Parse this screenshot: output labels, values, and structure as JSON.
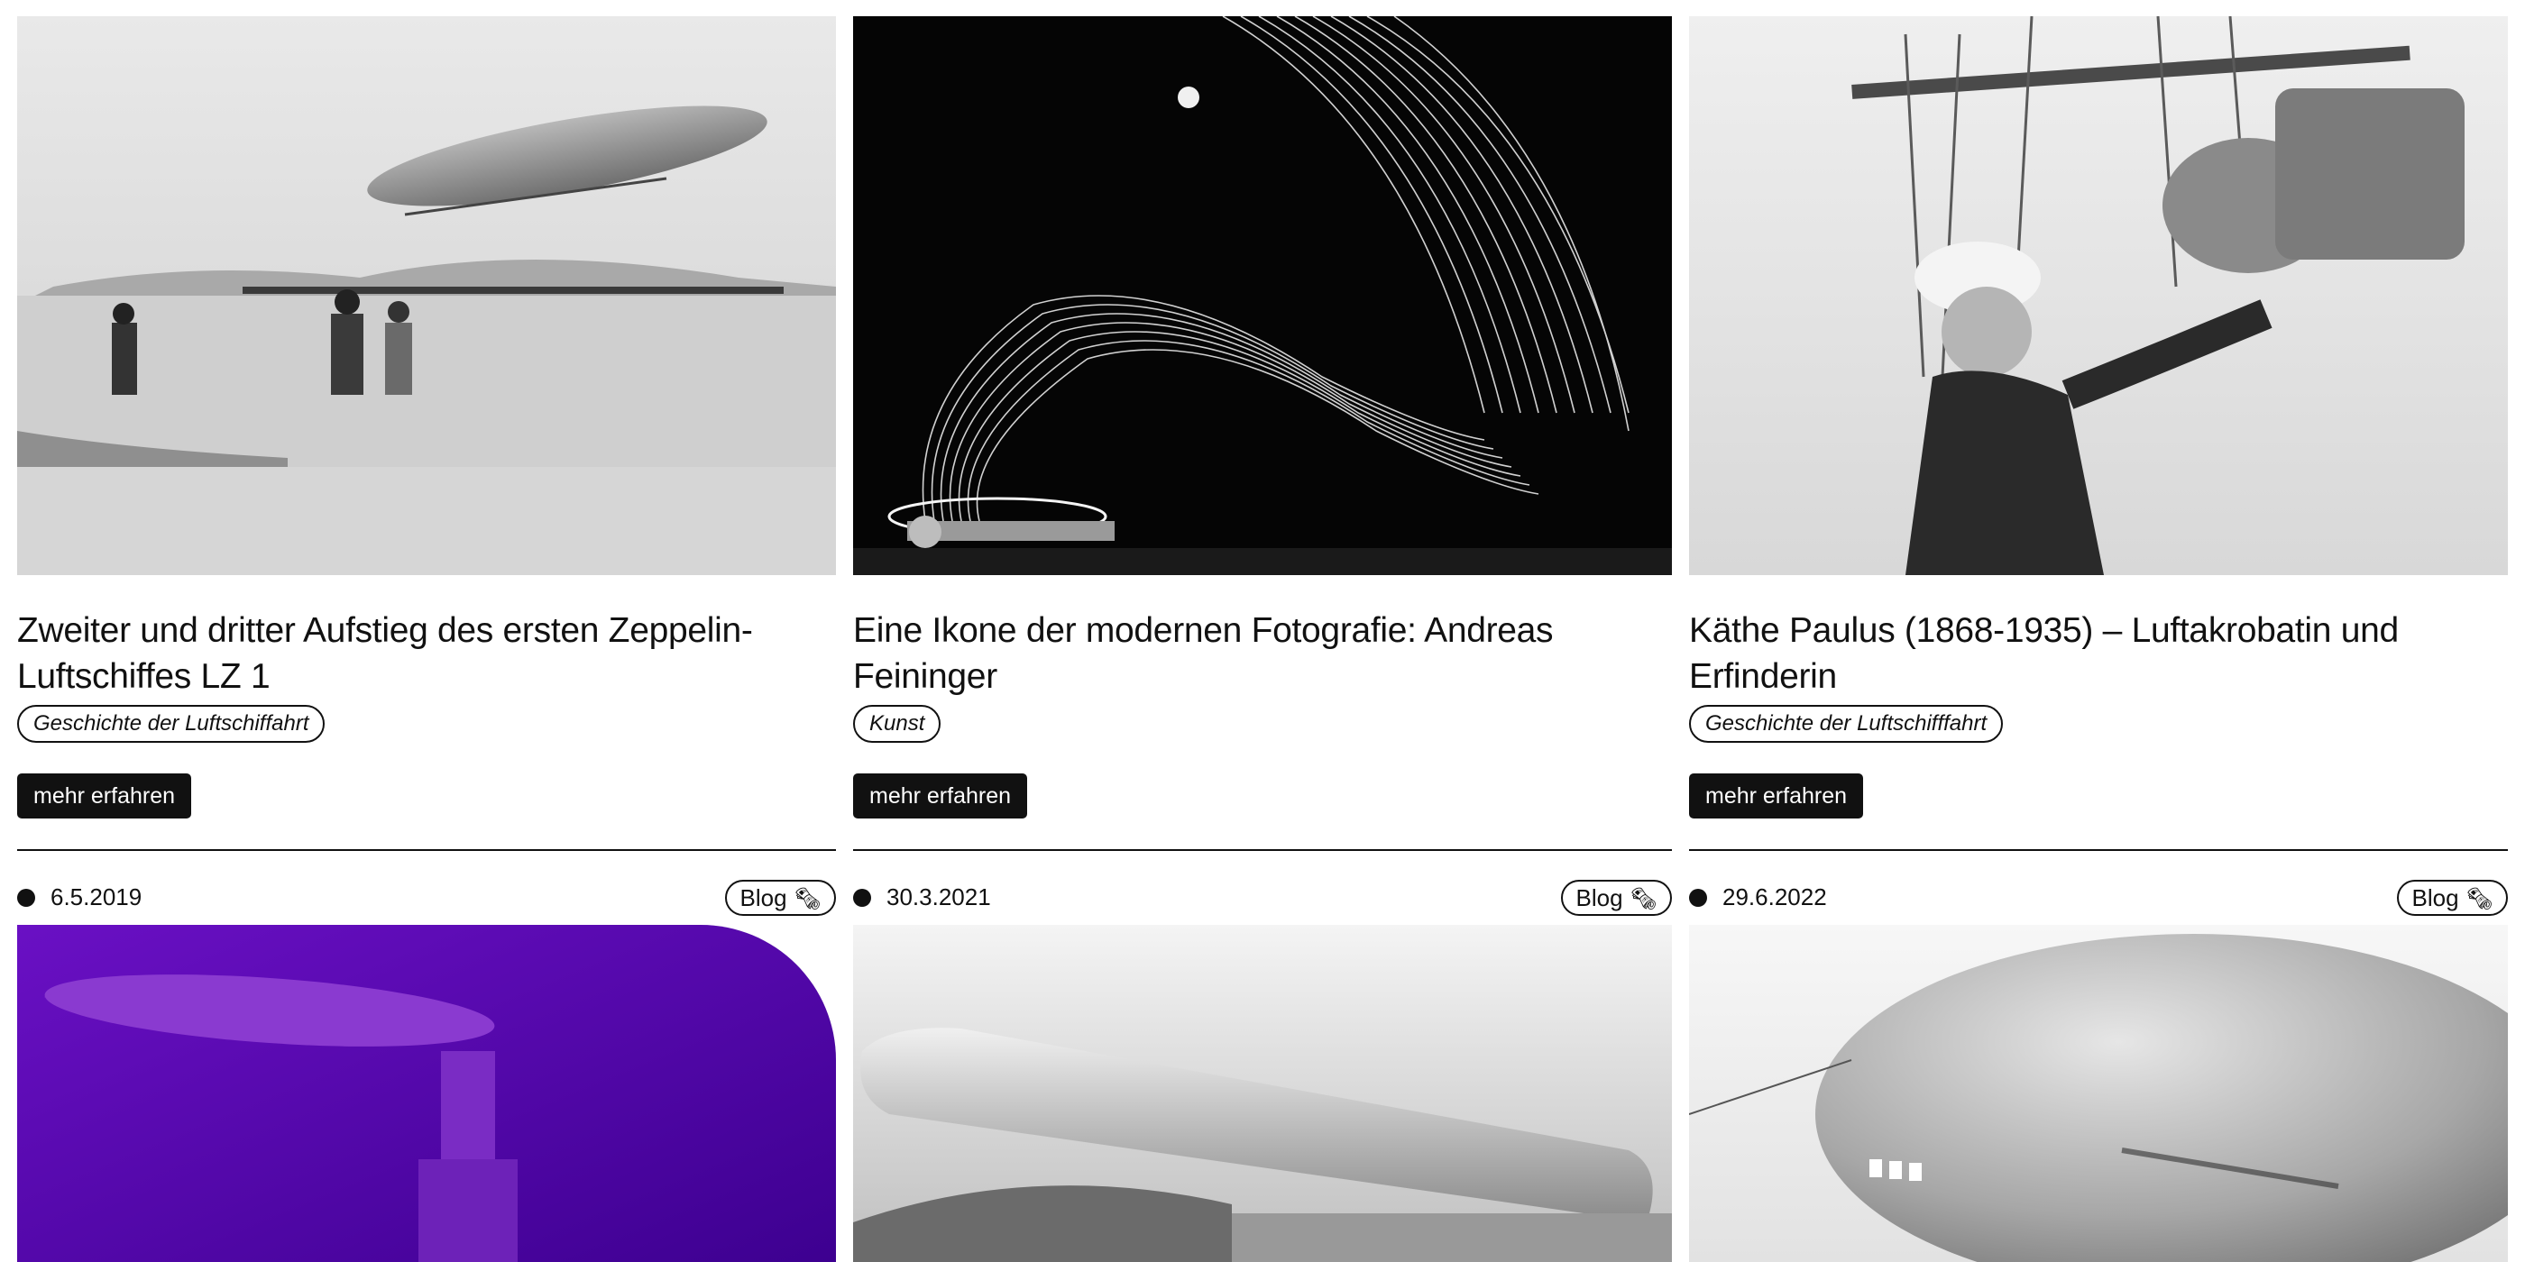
{
  "cards": [
    {
      "title": "Zweiter und dritter Aufstieg des ersten Zeppelin-Luftschiffes LZ 1",
      "tag": "Geschichte der Luftschiffahrt",
      "button": "mehr erfahren",
      "next": {
        "date": "6.5.2019",
        "badge": "Blog"
      }
    },
    {
      "title": "Eine Ikone der modernen Fotografie: Andreas Feininger",
      "tag": "Kunst",
      "button": "mehr erfahren",
      "next": {
        "date": "30.3.2021",
        "badge": "Blog"
      }
    },
    {
      "title": "Käthe Paulus (1868-1935) – Luftakrobatin und Erfinderin",
      "tag": "Geschichte der Luftschifffahrt",
      "button": "mehr erfahren",
      "next": {
        "date": "29.6.2022",
        "badge": "Blog"
      }
    }
  ],
  "icons": {
    "dot": "status-dot-icon",
    "blog": "document-icon"
  },
  "colors": {
    "text": "#111111",
    "button_bg": "#111111",
    "button_text": "#ffffff",
    "purple": "#5a00a8"
  }
}
